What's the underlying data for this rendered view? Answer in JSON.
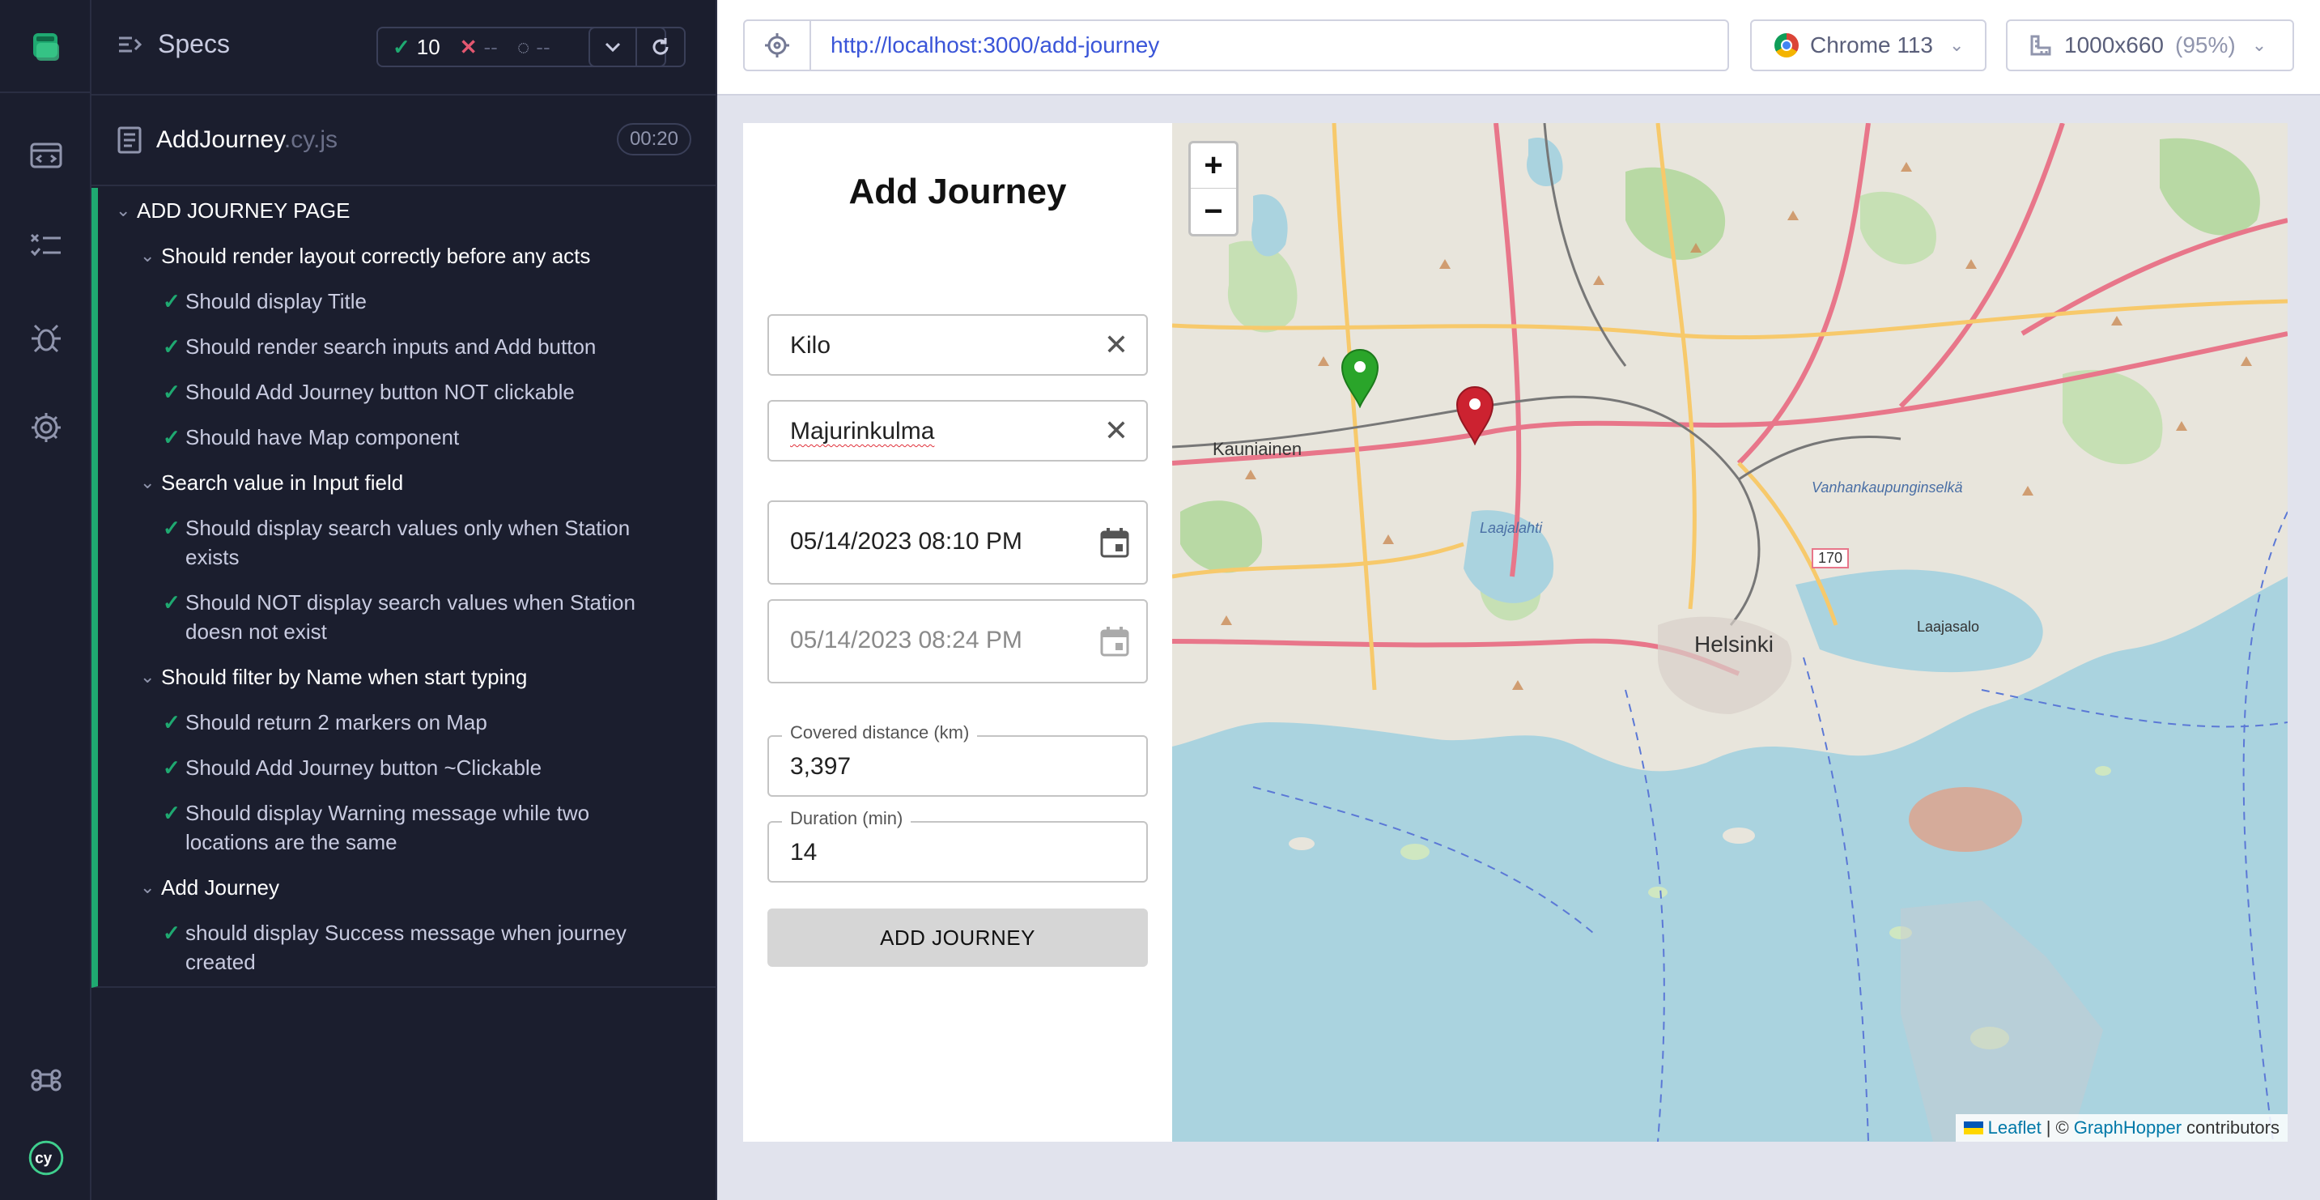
{
  "reporter": {
    "specs_label": "Specs",
    "stats": {
      "passed": "10",
      "failed": "--",
      "pending": "--"
    },
    "spec": {
      "name": "AddJourney",
      "ext": ".cy.js",
      "duration": "00:20"
    },
    "suites": [
      {
        "title": "ADD JOURNEY PAGE"
      },
      {
        "title": "Should render layout correctly before any acts",
        "tests": [
          "Should display Title",
          "Should render search inputs and Add button",
          "Should Add Journey button NOT clickable",
          "Should have Map component"
        ]
      },
      {
        "title": "Search value in Input field",
        "tests": [
          "Should display search values only when Station exists",
          "Should NOT display search values when Station doesn not exist"
        ]
      },
      {
        "title": "Should filter by Name when start typing",
        "tests": [
          "Should return 2 markers on Map",
          "Should Add Journey button ~Clickable",
          "Should display Warning message while two locations are the same"
        ]
      },
      {
        "title": "Add Journey",
        "tests": [
          "should display Success message when journey created"
        ]
      }
    ]
  },
  "aut": {
    "url": "http://localhost:3000/add-journey",
    "browser": "Chrome 113",
    "viewport": "1000x660",
    "viewport_scale": "(95%)"
  },
  "app": {
    "title": "Add Journey",
    "departure_station": "Kilo",
    "return_station": "Majurinkulma",
    "departure_time": "05/14/2023 08:10 PM",
    "return_time_placeholder": "05/14/2023 08:24 PM",
    "distance_label": "Covered distance (km)",
    "distance_value": "3,397",
    "duration_label": "Duration (min)",
    "duration_value": "14",
    "add_button": "ADD JOURNEY"
  },
  "map": {
    "zoom_in": "+",
    "zoom_out": "−",
    "labels": {
      "city": "Helsinki",
      "kauniainen": "Kauniainen",
      "laajalahti": "Laajalahti",
      "laajasalo": "Laajasalo",
      "vanhankaupunginselka": "Vanhankaupunginselkä",
      "road_170": "170"
    },
    "markers": {
      "departure_color": "#2aa52a",
      "return_color": "#cc2230"
    },
    "attribution": {
      "leaflet": "Leaflet",
      "sep": "| ©",
      "graphhopper": "GraphHopper",
      "contributors": "contributors"
    }
  }
}
